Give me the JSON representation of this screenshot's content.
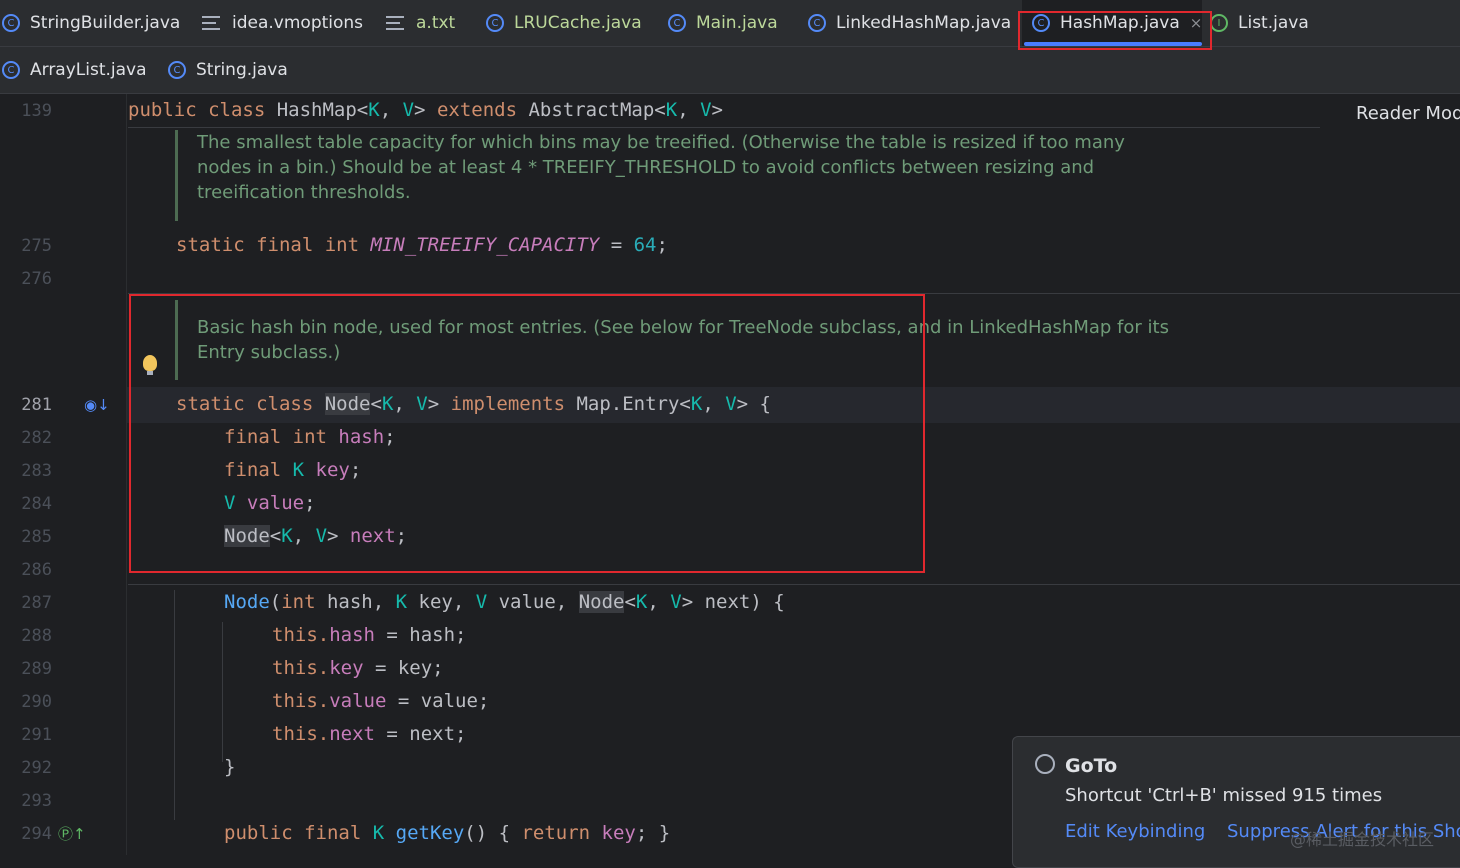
{
  "tabs_row1": [
    {
      "label": "StringBuilder.java",
      "icon": "class-icon"
    },
    {
      "label": "idea.vmoptions",
      "icon": "text-file-icon"
    },
    {
      "label": "a.txt",
      "icon": "text-file-icon"
    },
    {
      "label": "LRUCache.java",
      "icon": "class-icon"
    },
    {
      "label": "Main.java",
      "icon": "runnable-class-icon"
    },
    {
      "label": "LinkedHashMap.java",
      "icon": "class-icon"
    },
    {
      "label": "HashMap.java",
      "icon": "class-icon",
      "close": "×"
    },
    {
      "label": "List.java",
      "icon": "interface-icon"
    }
  ],
  "tabs_row2": [
    {
      "label": "ArrayList.java",
      "icon": "class-icon"
    },
    {
      "label": "String.java",
      "icon": "class-icon"
    }
  ],
  "reader_mode": "Reader Mod",
  "line_numbers": [
    "139",
    "275",
    "276",
    "281",
    "282",
    "283",
    "284",
    "285",
    "286",
    "287",
    "288",
    "289",
    "290",
    "291",
    "292",
    "293",
    "294"
  ],
  "code": {
    "l139": {
      "kw1": "public class ",
      "name": "HashMap",
      "p1": "<",
      "k": "K",
      ",": ", ",
      "v": "V",
      "gt": "> ",
      "ext": "extends ",
      "base": "AbstractMap",
      "p2": "<",
      "k2": "K",
      "c2": ", ",
      "v2": "V",
      "g2": ">"
    },
    "doc1": [
      "The smallest table capacity for which bins may be treeified. (Otherwise the table is resized if too many",
      "nodes in a bin.) Should be at least 4 * TREEIFY_THRESHOLD to avoid conflicts between resizing and",
      "treeification thresholds."
    ],
    "l275": {
      "kw": "static final int ",
      "const": "MIN_TREEIFY_CAPACITY",
      "eq": " = ",
      "num": "64",
      "semi": ";"
    },
    "doc2": [
      "Basic hash bin node, used for most entries. (See below for TreeNode subclass, and in LinkedHashMap for its",
      "Entry subclass.)"
    ],
    "l281": {
      "kw": "static class ",
      "name": "Node",
      "lt": "<",
      "k": "K",
      "c": ", ",
      "v": "V",
      "gt": "> ",
      "impl": "implements ",
      "iface": "Map.Entry<",
      "k2": "K",
      "c2": ", ",
      "v2": "V",
      "end": "> {"
    },
    "l282": {
      "kw": "final int ",
      "f": "hash",
      "s": ";"
    },
    "l283": {
      "kw": "final ",
      "t": "K",
      "sp": " ",
      "f": "key",
      "s": ";"
    },
    "l284": {
      "t": "V",
      "sp": " ",
      "f": "value",
      "s": ";"
    },
    "l285": {
      "name": "Node",
      "lt": "<",
      "k": "K",
      "c": ", ",
      "v": "V",
      "gt": "> ",
      "f": "next",
      "s": ";"
    },
    "l287": {
      "fn": "Node",
      "o": "(",
      "kw": "int ",
      "a1": "hash, ",
      "k": "K",
      "a2": " key, ",
      "v": "V",
      "a3": " value, ",
      "n": "Node",
      "lt": "<",
      "k2": "K",
      "c": ", ",
      "v2": "V",
      "end": "> next) {"
    },
    "l288": {
      "th": "this.",
      "f": "hash",
      "r": " = hash;"
    },
    "l289": {
      "th": "this.",
      "f": "key",
      "r": " = key;"
    },
    "l290": {
      "th": "this.",
      "f": "value",
      "r": " = value;"
    },
    "l291": {
      "th": "this.",
      "f": "next",
      "r": " = next;"
    },
    "l292": {
      "b": "}"
    },
    "l294": {
      "kw": "public final ",
      "t": "K",
      "sp": " ",
      "fn": "getKey",
      "r": "() { ",
      "ret": "return ",
      "f": "key",
      "e": "; }"
    }
  },
  "popup": {
    "title": "GoTo",
    "message": "Shortcut 'Ctrl+B' missed 915 times",
    "edit": "Edit Keybinding",
    "suppress": "Suppress Alert for this Shor"
  },
  "watermark": "@稀土掘金技术社区",
  "colors": {
    "accent": "#4a7dff",
    "highlight_box": "#e0282e",
    "background": "#1e1f22"
  }
}
